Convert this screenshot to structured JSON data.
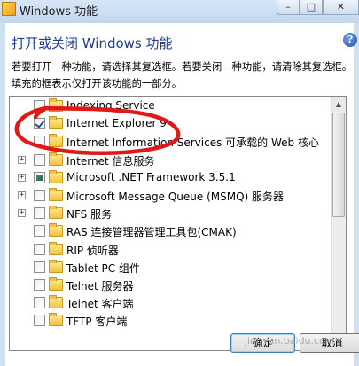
{
  "window": {
    "title": "Windows 功能",
    "controls": {
      "minimize": "–",
      "maximize": "□",
      "close": "✕"
    }
  },
  "dialog": {
    "heading": "打开或关闭 Windows 功能",
    "help": "?",
    "description": "若要打开一种功能，请选择其复选框。若要关闭一种功能，请清除其复选框。填充的框表示仅打开该功能的一部分。"
  },
  "features": [
    {
      "label": "Indexing Service",
      "state": "unchecked",
      "expandable": false
    },
    {
      "label": "Internet Explorer 9",
      "state": "checked",
      "expandable": false
    },
    {
      "label": "Internet Information Services 可承载的 Web 核心",
      "state": "unchecked",
      "expandable": false
    },
    {
      "label": "Internet 信息服务",
      "state": "unchecked",
      "expandable": true
    },
    {
      "label": "Microsoft .NET Framework 3.5.1",
      "state": "partial",
      "expandable": true
    },
    {
      "label": "Microsoft Message Queue (MSMQ) 服务器",
      "state": "unchecked",
      "expandable": true
    },
    {
      "label": "NFS 服务",
      "state": "unchecked",
      "expandable": true
    },
    {
      "label": "RAS 连接管理器管理工具包(CMAK)",
      "state": "unchecked",
      "expandable": false
    },
    {
      "label": "RIP 侦听器",
      "state": "unchecked",
      "expandable": false
    },
    {
      "label": "Tablet PC 组件",
      "state": "unchecked",
      "expandable": false
    },
    {
      "label": "Telnet 服务器",
      "state": "unchecked",
      "expandable": false
    },
    {
      "label": "Telnet 客户端",
      "state": "unchecked",
      "expandable": false
    },
    {
      "label": "TFTP 客户端",
      "state": "unchecked",
      "expandable": false
    }
  ],
  "buttons": {
    "ok": "确定",
    "cancel": "取消"
  },
  "watermark": "jingyan.baidu.com",
  "colors": {
    "annotation": "#e01818",
    "heading": "#1e3d8f"
  }
}
